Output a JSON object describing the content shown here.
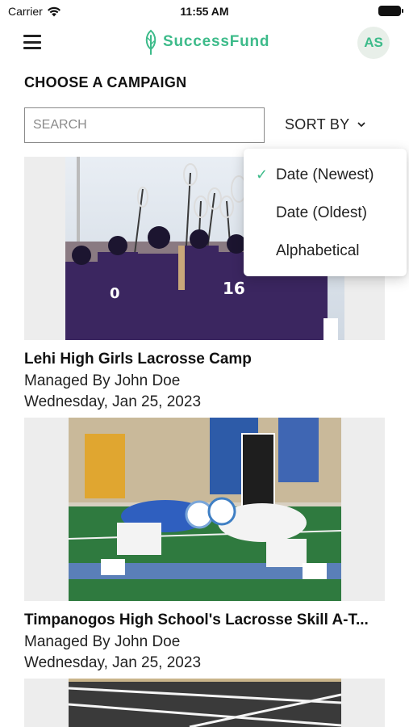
{
  "status_bar": {
    "carrier": "Carrier",
    "time": "11:55 AM"
  },
  "header": {
    "brand_name": "SuccessFund",
    "avatar_initials": "AS",
    "brand_color": "#3dbb8a"
  },
  "page": {
    "title": "CHOOSE A CAMPAIGN"
  },
  "search": {
    "placeholder": "SEARCH",
    "value": ""
  },
  "sort": {
    "label": "SORT BY",
    "selected": "Date (Newest)",
    "options": [
      {
        "label": "Date (Newest)",
        "checked": true
      },
      {
        "label": "Date (Oldest)",
        "checked": false
      },
      {
        "label": "Alphabetical",
        "checked": false
      }
    ]
  },
  "campaigns": [
    {
      "title": "Lehi High Girls Lacrosse Camp",
      "manager": "Managed By John Doe",
      "date": "Wednesday, Jan 25, 2023",
      "image": "lacrosse-team-huddle-photo"
    },
    {
      "title": "Timpanogos High School's Lacrosse Skill A-T...",
      "manager": "Managed By John Doe",
      "date": "Wednesday, Jan 25, 2023",
      "image": "lacrosse-faceoff-photo"
    },
    {
      "title": "",
      "manager": "",
      "date": "",
      "image": "track-photo"
    }
  ]
}
